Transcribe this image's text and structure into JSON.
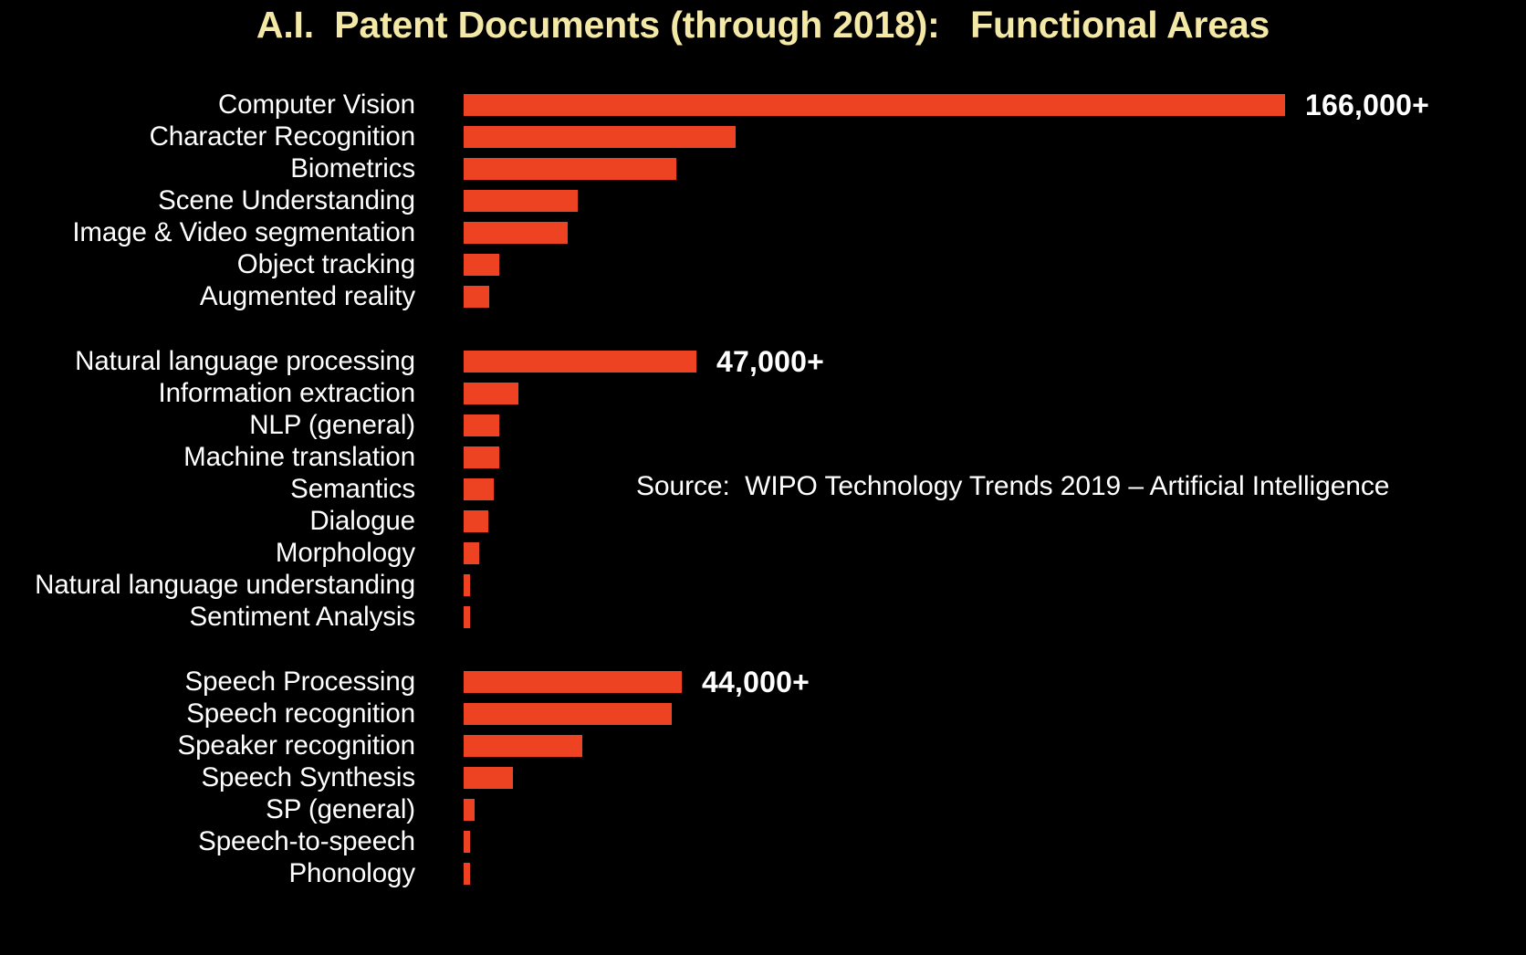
{
  "title": "A.I.  Patent Documents (through 2018):   Functional Areas",
  "source_note": "Source:  WIPO Technology Trends 2019 – Artificial Intelligence",
  "colors": {
    "background": "#000000",
    "title": "#f3e8a6",
    "bar": "#ee4323",
    "label": "#ffffff"
  },
  "chart_data": {
    "type": "bar",
    "orientation": "horizontal",
    "title": "A.I.  Patent Documents (through 2018):   Functional Areas",
    "xlabel": "",
    "ylabel": "",
    "grid": false,
    "legend": false,
    "axis_ticks": false,
    "xlim": [
      0,
      166000
    ],
    "unit": "patent documents",
    "note": "Source:  WIPO Technology Trends 2019 – Artificial Intelligence",
    "groups": [
      {
        "name": "Computer Vision",
        "categories": [
          "Computer Vision",
          "Character Recognition",
          "Biometrics",
          "Scene Understanding",
          "Image & Video segmentation",
          "Object tracking",
          "Augmented reality"
        ],
        "values": [
          166000,
          55000,
          43000,
          23000,
          21000,
          7200,
          5200
        ],
        "labels": [
          "166,000+",
          "",
          "",
          "",
          "",
          "",
          ""
        ]
      },
      {
        "name": "Natural language processing",
        "categories": [
          "Natural language processing",
          "Information extraction",
          "NLP (general)",
          "Machine translation",
          "Semantics",
          "Dialogue",
          "Morphology",
          "Natural language understanding",
          "Sentiment Analysis"
        ],
        "values": [
          47000,
          11000,
          7200,
          7200,
          6100,
          5000,
          3100,
          1300,
          1300
        ],
        "labels": [
          "47,000+",
          "",
          "",
          "",
          "",
          "",
          "",
          "",
          ""
        ]
      },
      {
        "name": "Speech Processing",
        "categories": [
          "Speech Processing",
          "Speech recognition",
          "Speaker recognition",
          "Speech Synthesis",
          "SP (general)",
          "Speech-to-speech",
          "Phonology"
        ],
        "values": [
          44000,
          42000,
          24000,
          10000,
          2200,
          1300,
          1300
        ],
        "labels": [
          "44,000+",
          "",
          "",
          "",
          "",
          "",
          ""
        ]
      }
    ]
  }
}
